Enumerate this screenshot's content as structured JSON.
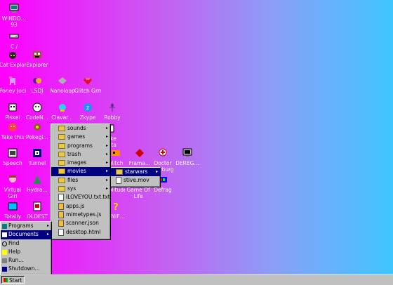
{
  "desktop": {
    "icons": [
      {
        "label": "WINDO…\n93"
      },
      {
        "label": "C:/"
      },
      {
        "label": "Cat Explorer"
      },
      {
        "label": "Explorer"
      },
      {
        "label": "Poney Jockey"
      },
      {
        "label": "LSDJ"
      },
      {
        "label": "Nanoloop"
      },
      {
        "label": "Glitch Grrrlz"
      },
      {
        "label": "Piskel"
      },
      {
        "label": "CodeN…"
      },
      {
        "label": "Clavar…"
      },
      {
        "label": "Zkype"
      },
      {
        "label": "Robby"
      },
      {
        "label": "Take this"
      },
      {
        "label": "Pokegl…"
      },
      {
        "label": "Puke Data"
      },
      {
        "label": "Speech"
      },
      {
        "label": "Tunnel"
      },
      {
        "label": "glitch"
      },
      {
        "label": "Frama…"
      },
      {
        "label": "Doctor Marburg"
      },
      {
        "label": "DEREG…"
      },
      {
        "label": "Virtual Girl"
      },
      {
        "label": "Hydra…"
      },
      {
        "label": "Solitude"
      },
      {
        "label": "Game Of Life"
      },
      {
        "label": "Defrag"
      },
      {
        "label": "Totally"
      },
      {
        "label": "OLDEST"
      },
      {
        "label": "MNIF…"
      }
    ]
  },
  "start_menu": {
    "items": [
      {
        "label": "Programs",
        "arrow": "▸"
      },
      {
        "label": "Documents",
        "arrow": "▸"
      },
      {
        "label": "Find"
      },
      {
        "label": "Help"
      },
      {
        "label": "Run..."
      },
      {
        "label": "Shutdown..."
      }
    ]
  },
  "documents_menu": {
    "items": [
      {
        "label": "sounds",
        "arrow": "▸"
      },
      {
        "label": "games",
        "arrow": "▸"
      },
      {
        "label": "programs",
        "arrow": "▸"
      },
      {
        "label": "trash",
        "arrow": "▸"
      },
      {
        "label": "images",
        "arrow": "▸"
      },
      {
        "label": "movies",
        "arrow": "▸"
      },
      {
        "label": "files",
        "arrow": "▸"
      },
      {
        "label": "sys",
        "arrow": "▸"
      },
      {
        "label": "ILOVEYOU.txt.txt"
      },
      {
        "label": "apps.js"
      },
      {
        "label": "mimetypes.js"
      },
      {
        "label": "scanner.json"
      },
      {
        "label": "desktop.html"
      }
    ]
  },
  "movies_menu": {
    "items": [
      {
        "label": "starwars",
        "arrow": "▸"
      },
      {
        "label": "stive.mov"
      }
    ]
  },
  "taskbar": {
    "start_label": "Start"
  }
}
